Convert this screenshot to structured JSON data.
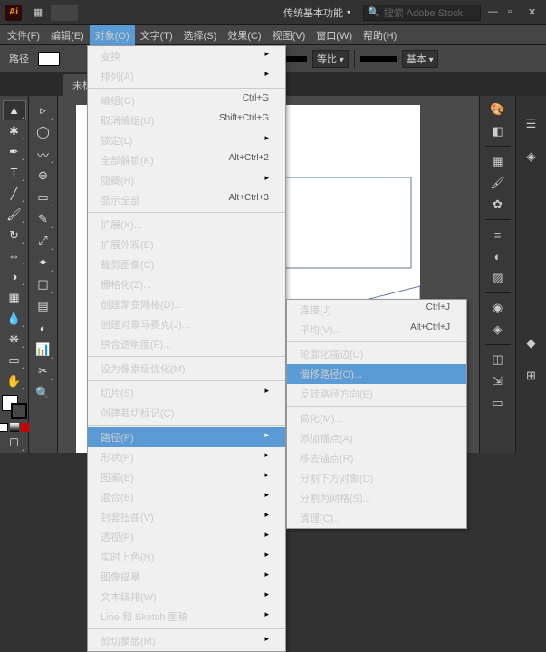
{
  "titlebar": {
    "logo": "Ai",
    "workspace": "传统基本功能",
    "search_placeholder": "搜索 Adobe Stock"
  },
  "menubar": [
    "文件(F)",
    "编辑(E)",
    "对象(O)",
    "文字(T)",
    "选择(S)",
    "效果(C)",
    "视图(V)",
    "窗口(W)",
    "帮助(H)"
  ],
  "controlbar": {
    "label": "路径",
    "align": "等比",
    "style": "基本"
  },
  "tab": {
    "name": "未标"
  },
  "object_menu": [
    {
      "label": "变换",
      "sub": true
    },
    {
      "label": "排列(A)",
      "sub": true
    },
    {
      "sep": true
    },
    {
      "label": "编组(G)",
      "shortcut": "Ctrl+G"
    },
    {
      "label": "取消编组(U)",
      "shortcut": "Shift+Ctrl+G",
      "disabled": true
    },
    {
      "label": "锁定(L)",
      "sub": true
    },
    {
      "label": "全部解锁(K)",
      "shortcut": "Alt+Ctrl+2",
      "disabled": true
    },
    {
      "label": "隐藏(H)",
      "sub": true
    },
    {
      "label": "显示全部",
      "shortcut": "Alt+Ctrl+3",
      "disabled": true
    },
    {
      "sep": true
    },
    {
      "label": "扩展(X)..."
    },
    {
      "label": "扩展外观(E)",
      "disabled": true
    },
    {
      "label": "裁剪图像(C)",
      "disabled": true
    },
    {
      "label": "栅格化(Z)..."
    },
    {
      "label": "创建渐变网格(D)..."
    },
    {
      "label": "创建对象马赛克(J)...",
      "disabled": true
    },
    {
      "label": "拼合透明度(F)..."
    },
    {
      "sep": true
    },
    {
      "label": "设为像素级优化(M)"
    },
    {
      "sep": true
    },
    {
      "label": "切片(S)",
      "sub": true
    },
    {
      "label": "创建裁切标记(C)"
    },
    {
      "sep": true
    },
    {
      "label": "路径(P)",
      "sub": true,
      "hover": true
    },
    {
      "label": "形状(P)",
      "sub": true
    },
    {
      "label": "图案(E)",
      "sub": true
    },
    {
      "label": "混合(B)",
      "sub": true
    },
    {
      "label": "封套扭曲(V)",
      "sub": true
    },
    {
      "label": "透视(P)",
      "sub": true
    },
    {
      "label": "实时上色(N)",
      "sub": true
    },
    {
      "label": "图像描摹",
      "sub": true
    },
    {
      "label": "文本绕排(W)",
      "sub": true
    },
    {
      "label": "Line 和 Sketch 图稿",
      "sub": true
    },
    {
      "sep": true
    },
    {
      "label": "剪切蒙版(M)",
      "sub": true
    }
  ],
  "path_submenu": [
    {
      "label": "连接(J)",
      "shortcut": "Ctrl+J"
    },
    {
      "label": "平均(V)...",
      "shortcut": "Alt+Ctrl+J"
    },
    {
      "sep": true
    },
    {
      "label": "轮廓化描边(U)"
    },
    {
      "label": "偏移路径(O)...",
      "hover": true
    },
    {
      "label": "反转路径方向(E)",
      "disabled": true
    },
    {
      "sep": true
    },
    {
      "label": "简化(M)..."
    },
    {
      "label": "添加锚点(A)"
    },
    {
      "label": "移去锚点(R)",
      "disabled": true
    },
    {
      "label": "分割下方对象(D)",
      "disabled": true
    },
    {
      "label": "分割为网格(S)..."
    },
    {
      "label": "清理(C)..."
    }
  ]
}
